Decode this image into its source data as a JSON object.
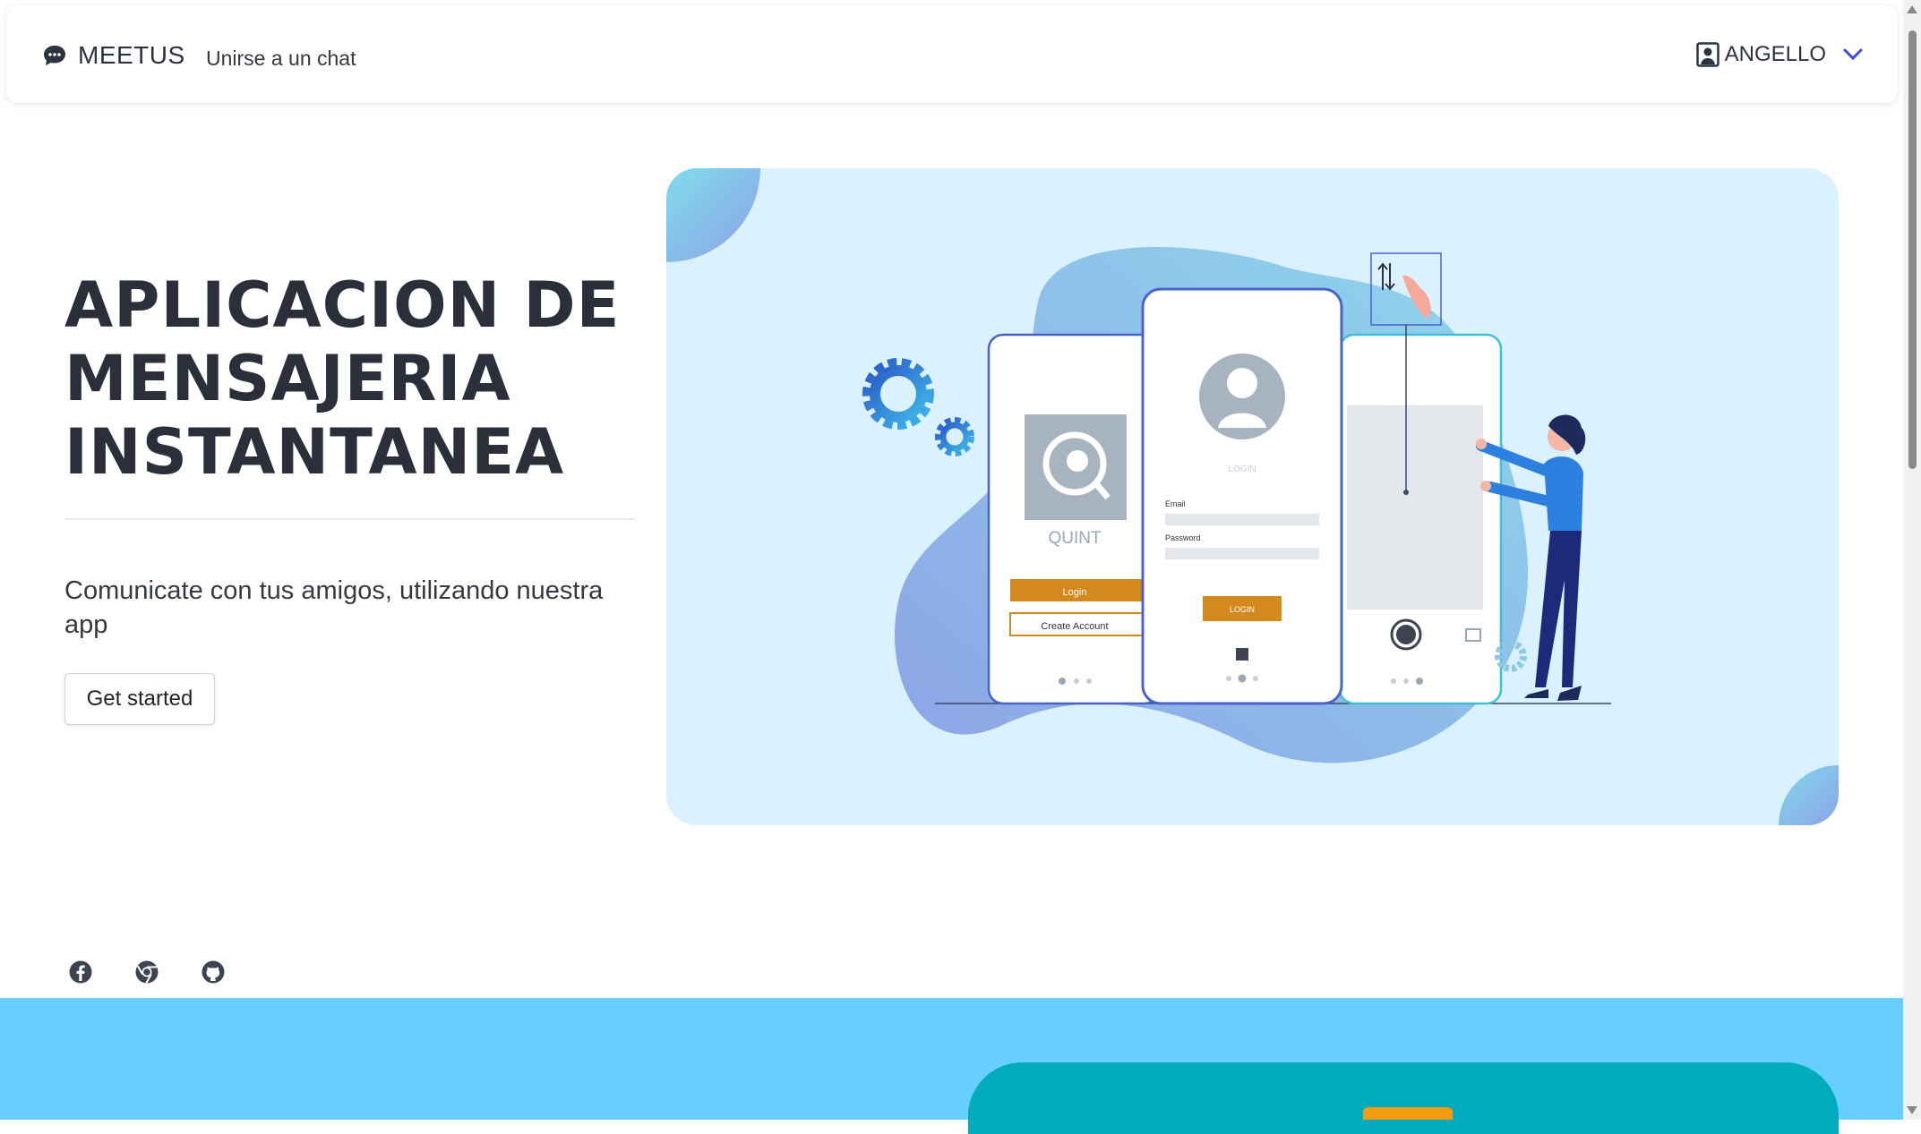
{
  "navbar": {
    "brand": "MEETUS",
    "links": [
      "Unirse a un chat"
    ],
    "user": "ANGELLO"
  },
  "hero": {
    "title_lines": [
      "APLICACION DE",
      "MENSAJERIA",
      "INSTANTANEA"
    ],
    "subtitle": "Comunicate con tus amigos, utilizando nuestra app",
    "cta": "Get started"
  },
  "illustration": {
    "app_name": "QUINT",
    "login_button": "Login",
    "create_account_button": "Create Account",
    "login_heading": "LOGIN",
    "email_label": "Email",
    "password_label": "Password",
    "login_button_2": "LOGIN"
  },
  "socials": [
    "facebook-icon",
    "chrome-icon",
    "github-icon"
  ],
  "colors": {
    "footer_band": "#66cfff",
    "teal_card": "#00abbe",
    "accent_orange": "#d4891f",
    "illustration_bg": "#dbf1fd"
  }
}
